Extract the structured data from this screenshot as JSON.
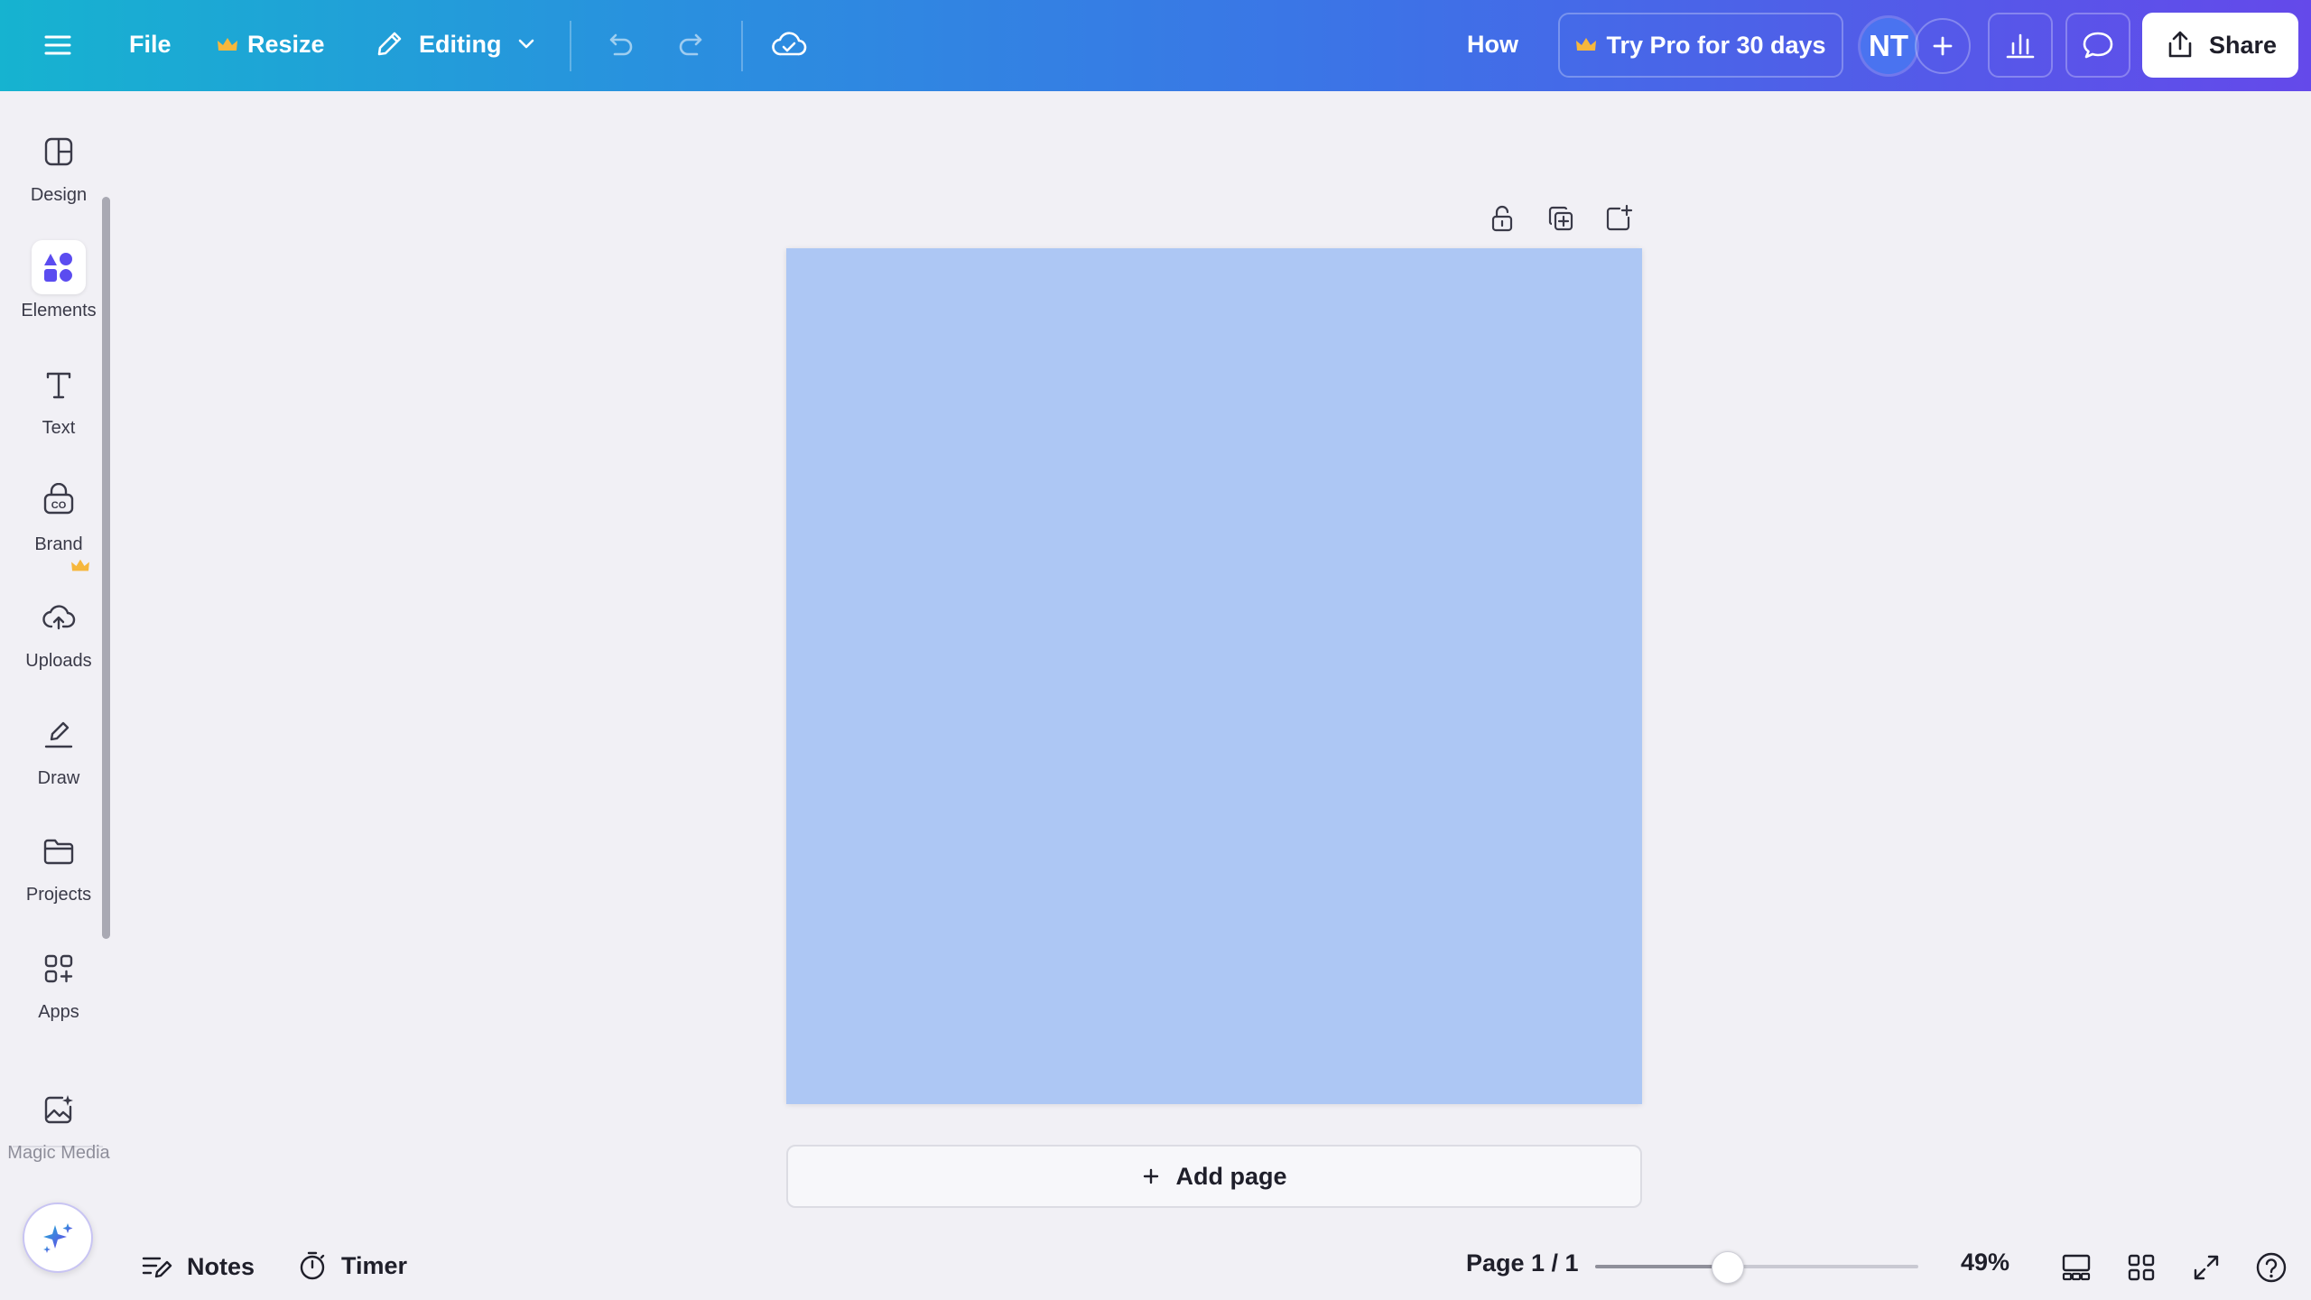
{
  "topbar": {
    "file_label": "File",
    "resize_label": "Resize",
    "editing_label": "Editing",
    "how_label": "How",
    "trial_label": "Try Pro for 30 days",
    "avatar_initials": "NT",
    "share_label": "Share",
    "icons": [
      "menu-icon",
      "crown-icon",
      "pencil-icon",
      "chevron-down-icon",
      "undo-icon",
      "redo-icon",
      "cloud-check-icon",
      "plus-icon",
      "analytics-icon",
      "comment-icon",
      "share-upload-icon"
    ]
  },
  "sidebar": {
    "items": [
      {
        "label": "Design",
        "icon": "layout-icon"
      },
      {
        "label": "Elements",
        "icon": "shapes-icon"
      },
      {
        "label": "Text",
        "icon": "text-icon"
      },
      {
        "label": "Brand",
        "icon": "brand-icon"
      },
      {
        "label": "Uploads",
        "icon": "cloud-upload-icon"
      },
      {
        "label": "Draw",
        "icon": "draw-icon"
      },
      {
        "label": "Projects",
        "icon": "folder-icon"
      },
      {
        "label": "Apps",
        "icon": "apps-icon"
      },
      {
        "label": "Magic Media",
        "icon": "magic-media-icon"
      }
    ],
    "active_item": "Elements"
  },
  "canvas": {
    "page_color": "#adc7f4",
    "add_page_label": "Add page"
  },
  "bottombar": {
    "notes_label": "Notes",
    "timer_label": "Timer",
    "page_indicator": "Page 1 / 1",
    "zoom_label": "49%",
    "zoom_fraction": 0.42
  },
  "colors": {
    "accent": "#6449ea",
    "gradient_start": "#16b3d0",
    "gradient_end": "#6449ea",
    "crown": "#f6b73c",
    "elements_icon": "#5b4cf0"
  }
}
